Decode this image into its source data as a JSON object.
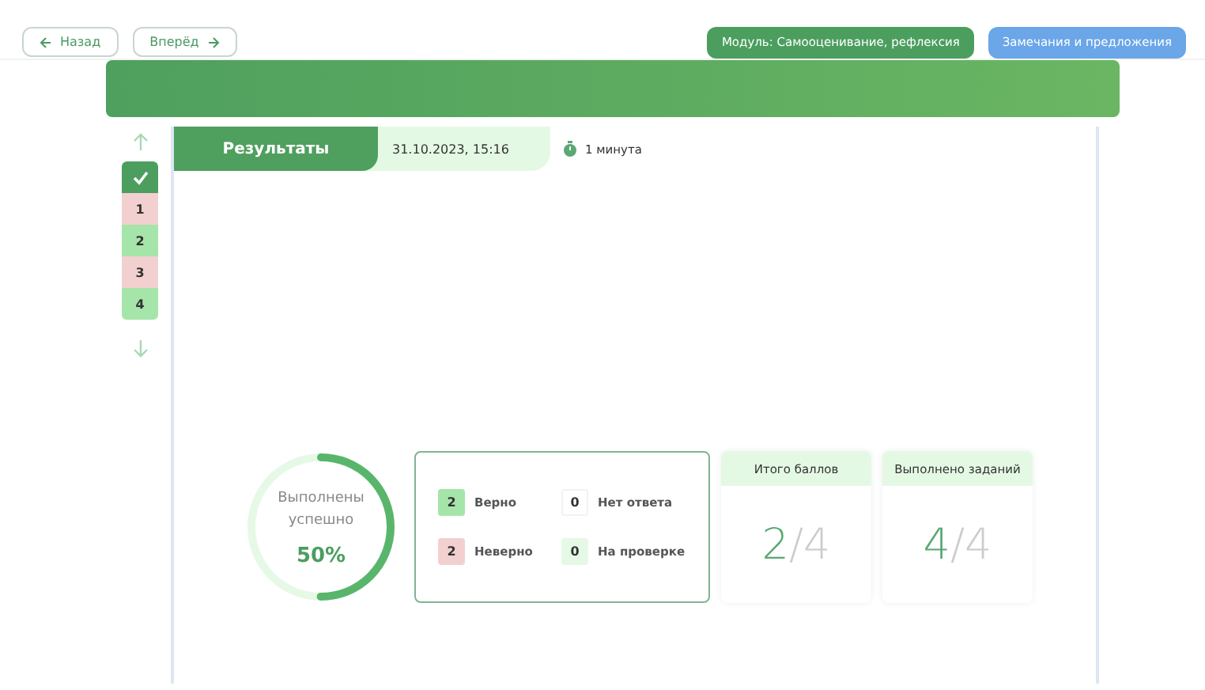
{
  "nav": {
    "back": "Назад",
    "forward": "Вперёд"
  },
  "actions": [
    {
      "label": "Модуль: Самооценивание, рефлексия",
      "kind": "primary"
    },
    {
      "label": "Замечания и предложения",
      "kind": "secondary"
    }
  ],
  "header": {
    "title": "Результаты",
    "date": "31.10.2023,  15:16",
    "duration": "1 минута"
  },
  "tasks": [
    {
      "kind": "summary",
      "selected": true
    },
    {
      "kind": "task",
      "label": "1",
      "color": "#f3d0d0",
      "selected": false
    },
    {
      "kind": "task",
      "label": "2",
      "color": "#a6e5a9",
      "selected": false
    },
    {
      "kind": "task",
      "label": "3",
      "color": "#f3d0d0",
      "selected": false
    },
    {
      "kind": "task",
      "label": "4",
      "color": "#a6e5a9",
      "selected": false
    }
  ],
  "progress": {
    "caption": "Выполнены успешно",
    "percent": "50%",
    "level": 0.5
  },
  "legend": [
    {
      "count": "2",
      "label": "Верно",
      "kind": "correct"
    },
    {
      "count": "0",
      "label": "Нет ответа",
      "kind": "none"
    },
    {
      "count": "2",
      "label": "Неверно",
      "kind": "wrong"
    },
    {
      "count": "0",
      "label": "На проверке",
      "kind": "review"
    }
  ],
  "cards": [
    {
      "title": "Итого баллов",
      "value": "2",
      "separator": "/",
      "total": "4"
    },
    {
      "title": "Выполнено заданий",
      "value": "4",
      "separator": "/",
      "total": "4"
    }
  ]
}
